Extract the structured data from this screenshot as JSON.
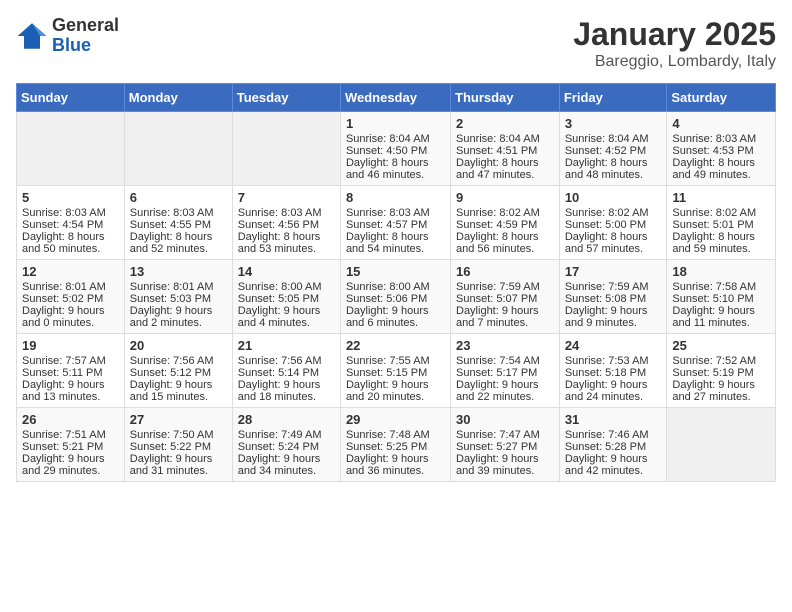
{
  "logo": {
    "general": "General",
    "blue": "Blue"
  },
  "title": "January 2025",
  "location": "Bareggio, Lombardy, Italy",
  "days_of_week": [
    "Sunday",
    "Monday",
    "Tuesday",
    "Wednesday",
    "Thursday",
    "Friday",
    "Saturday"
  ],
  "weeks": [
    [
      {
        "day": "",
        "sunrise": "",
        "sunset": "",
        "daylight": ""
      },
      {
        "day": "",
        "sunrise": "",
        "sunset": "",
        "daylight": ""
      },
      {
        "day": "",
        "sunrise": "",
        "sunset": "",
        "daylight": ""
      },
      {
        "day": "1",
        "sunrise": "Sunrise: 8:04 AM",
        "sunset": "Sunset: 4:50 PM",
        "daylight": "Daylight: 8 hours and 46 minutes."
      },
      {
        "day": "2",
        "sunrise": "Sunrise: 8:04 AM",
        "sunset": "Sunset: 4:51 PM",
        "daylight": "Daylight: 8 hours and 47 minutes."
      },
      {
        "day": "3",
        "sunrise": "Sunrise: 8:04 AM",
        "sunset": "Sunset: 4:52 PM",
        "daylight": "Daylight: 8 hours and 48 minutes."
      },
      {
        "day": "4",
        "sunrise": "Sunrise: 8:03 AM",
        "sunset": "Sunset: 4:53 PM",
        "daylight": "Daylight: 8 hours and 49 minutes."
      }
    ],
    [
      {
        "day": "5",
        "sunrise": "Sunrise: 8:03 AM",
        "sunset": "Sunset: 4:54 PM",
        "daylight": "Daylight: 8 hours and 50 minutes."
      },
      {
        "day": "6",
        "sunrise": "Sunrise: 8:03 AM",
        "sunset": "Sunset: 4:55 PM",
        "daylight": "Daylight: 8 hours and 52 minutes."
      },
      {
        "day": "7",
        "sunrise": "Sunrise: 8:03 AM",
        "sunset": "Sunset: 4:56 PM",
        "daylight": "Daylight: 8 hours and 53 minutes."
      },
      {
        "day": "8",
        "sunrise": "Sunrise: 8:03 AM",
        "sunset": "Sunset: 4:57 PM",
        "daylight": "Daylight: 8 hours and 54 minutes."
      },
      {
        "day": "9",
        "sunrise": "Sunrise: 8:02 AM",
        "sunset": "Sunset: 4:59 PM",
        "daylight": "Daylight: 8 hours and 56 minutes."
      },
      {
        "day": "10",
        "sunrise": "Sunrise: 8:02 AM",
        "sunset": "Sunset: 5:00 PM",
        "daylight": "Daylight: 8 hours and 57 minutes."
      },
      {
        "day": "11",
        "sunrise": "Sunrise: 8:02 AM",
        "sunset": "Sunset: 5:01 PM",
        "daylight": "Daylight: 8 hours and 59 minutes."
      }
    ],
    [
      {
        "day": "12",
        "sunrise": "Sunrise: 8:01 AM",
        "sunset": "Sunset: 5:02 PM",
        "daylight": "Daylight: 9 hours and 0 minutes."
      },
      {
        "day": "13",
        "sunrise": "Sunrise: 8:01 AM",
        "sunset": "Sunset: 5:03 PM",
        "daylight": "Daylight: 9 hours and 2 minutes."
      },
      {
        "day": "14",
        "sunrise": "Sunrise: 8:00 AM",
        "sunset": "Sunset: 5:05 PM",
        "daylight": "Daylight: 9 hours and 4 minutes."
      },
      {
        "day": "15",
        "sunrise": "Sunrise: 8:00 AM",
        "sunset": "Sunset: 5:06 PM",
        "daylight": "Daylight: 9 hours and 6 minutes."
      },
      {
        "day": "16",
        "sunrise": "Sunrise: 7:59 AM",
        "sunset": "Sunset: 5:07 PM",
        "daylight": "Daylight: 9 hours and 7 minutes."
      },
      {
        "day": "17",
        "sunrise": "Sunrise: 7:59 AM",
        "sunset": "Sunset: 5:08 PM",
        "daylight": "Daylight: 9 hours and 9 minutes."
      },
      {
        "day": "18",
        "sunrise": "Sunrise: 7:58 AM",
        "sunset": "Sunset: 5:10 PM",
        "daylight": "Daylight: 9 hours and 11 minutes."
      }
    ],
    [
      {
        "day": "19",
        "sunrise": "Sunrise: 7:57 AM",
        "sunset": "Sunset: 5:11 PM",
        "daylight": "Daylight: 9 hours and 13 minutes."
      },
      {
        "day": "20",
        "sunrise": "Sunrise: 7:56 AM",
        "sunset": "Sunset: 5:12 PM",
        "daylight": "Daylight: 9 hours and 15 minutes."
      },
      {
        "day": "21",
        "sunrise": "Sunrise: 7:56 AM",
        "sunset": "Sunset: 5:14 PM",
        "daylight": "Daylight: 9 hours and 18 minutes."
      },
      {
        "day": "22",
        "sunrise": "Sunrise: 7:55 AM",
        "sunset": "Sunset: 5:15 PM",
        "daylight": "Daylight: 9 hours and 20 minutes."
      },
      {
        "day": "23",
        "sunrise": "Sunrise: 7:54 AM",
        "sunset": "Sunset: 5:17 PM",
        "daylight": "Daylight: 9 hours and 22 minutes."
      },
      {
        "day": "24",
        "sunrise": "Sunrise: 7:53 AM",
        "sunset": "Sunset: 5:18 PM",
        "daylight": "Daylight: 9 hours and 24 minutes."
      },
      {
        "day": "25",
        "sunrise": "Sunrise: 7:52 AM",
        "sunset": "Sunset: 5:19 PM",
        "daylight": "Daylight: 9 hours and 27 minutes."
      }
    ],
    [
      {
        "day": "26",
        "sunrise": "Sunrise: 7:51 AM",
        "sunset": "Sunset: 5:21 PM",
        "daylight": "Daylight: 9 hours and 29 minutes."
      },
      {
        "day": "27",
        "sunrise": "Sunrise: 7:50 AM",
        "sunset": "Sunset: 5:22 PM",
        "daylight": "Daylight: 9 hours and 31 minutes."
      },
      {
        "day": "28",
        "sunrise": "Sunrise: 7:49 AM",
        "sunset": "Sunset: 5:24 PM",
        "daylight": "Daylight: 9 hours and 34 minutes."
      },
      {
        "day": "29",
        "sunrise": "Sunrise: 7:48 AM",
        "sunset": "Sunset: 5:25 PM",
        "daylight": "Daylight: 9 hours and 36 minutes."
      },
      {
        "day": "30",
        "sunrise": "Sunrise: 7:47 AM",
        "sunset": "Sunset: 5:27 PM",
        "daylight": "Daylight: 9 hours and 39 minutes."
      },
      {
        "day": "31",
        "sunrise": "Sunrise: 7:46 AM",
        "sunset": "Sunset: 5:28 PM",
        "daylight": "Daylight: 9 hours and 42 minutes."
      },
      {
        "day": "",
        "sunrise": "",
        "sunset": "",
        "daylight": ""
      }
    ]
  ]
}
